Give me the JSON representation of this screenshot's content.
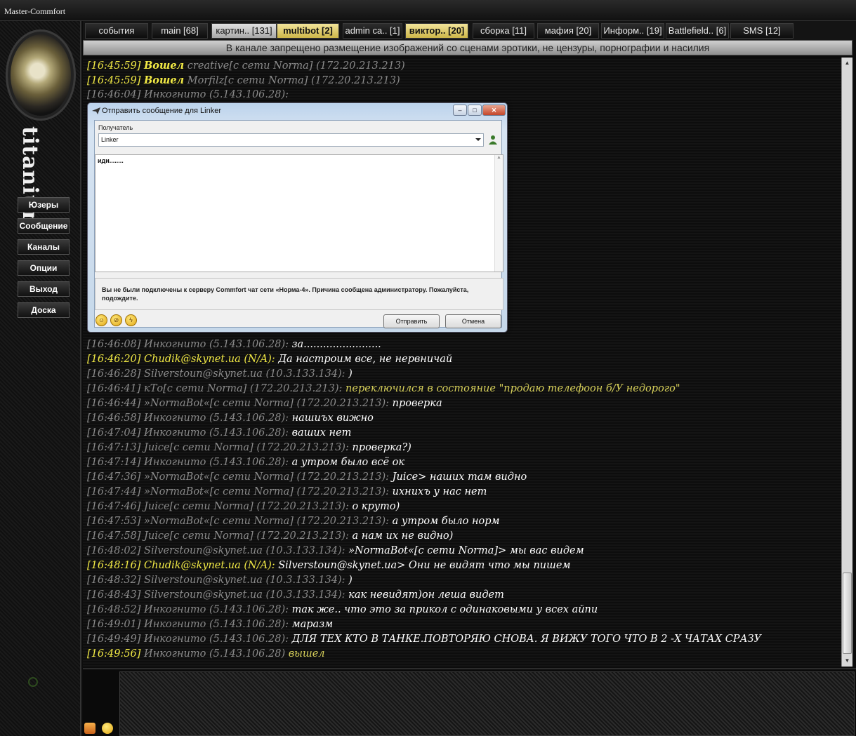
{
  "window": {
    "title": "Master-Commfort"
  },
  "sidebar": {
    "brand": "titanium",
    "buttons": [
      "Юзеры",
      "Сообщение",
      "Каналы",
      "Опции",
      "Выход",
      "Доска"
    ]
  },
  "tabs": [
    {
      "label": "события"
    },
    {
      "label": "main [68]"
    },
    {
      "label": "картин.. [131]"
    },
    {
      "label": "multibot [2]"
    },
    {
      "label": "admin ca.. [1]"
    },
    {
      "label": "виктор.. [20]"
    },
    {
      "label": "сборка [11]"
    },
    {
      "label": "мафия [20]"
    },
    {
      "label": "Информ.. [19]"
    },
    {
      "label": "Battlefield.. [6]"
    },
    {
      "label": "SMS [12]"
    }
  ],
  "notice": "В канале запрещено размещение изображений со сценами эротики, не цензуры, порнографии и насилия",
  "chat": [
    {
      "ts": "[16:45:59]",
      "nick": "Вошел",
      "msg": "creative[с сети Norma] (172.20.213.213)"
    },
    {
      "ts": "[16:45:59]",
      "nick": "Вошел",
      "msg": "Morfilz[с сети Norma] (172.20.213.213)"
    },
    {
      "ts": "[16:46:04]",
      "nick": "Инкогнито (5.143.106.28):",
      "msg": ""
    },
    {
      "ts": "[16:46:08]",
      "nick": "Инкогнито (5.143.106.28):",
      "msg": "за........................"
    },
    {
      "ts": "[16:46:20]",
      "nick": "Chudik@skynet.ua (N/A):",
      "msg": "Да настроим все, не нервничай"
    },
    {
      "ts": "[16:46:28]",
      "nick": "Silverstoun@skynet.ua (10.3.133.134):",
      "msg": ")"
    },
    {
      "ts": "[16:46:41]",
      "nick": "кТо[с сети Norma] (172.20.213.213):",
      "msg": "переключился в состояние \"продаю телефоон б/У недорого\""
    },
    {
      "ts": "[16:46:44]",
      "nick": "»NormaBot«[с сети Norma] (172.20.213.213):",
      "msg": "проверка"
    },
    {
      "ts": "[16:46:58]",
      "nick": "Инкогнито (5.143.106.28):",
      "msg": "нашиъх вижно"
    },
    {
      "ts": "[16:47:04]",
      "nick": "Инкогнито (5.143.106.28):",
      "msg": "ваших нет"
    },
    {
      "ts": "[16:47:13]",
      "nick": "Juice[с сети Norma] (172.20.213.213):",
      "msg": "проверка?)"
    },
    {
      "ts": "[16:47:14]",
      "nick": "Инкогнито (5.143.106.28):",
      "msg": "а утром было всё ок"
    },
    {
      "ts": "[16:47:36]",
      "nick": "»NormaBot«[с сети Norma] (172.20.213.213):",
      "msg": "Juice> наших там видно"
    },
    {
      "ts": "[16:47:44]",
      "nick": "»NormaBot«[с сети Norma] (172.20.213.213):",
      "msg": "ихнихъ у нас нет"
    },
    {
      "ts": "[16:47:46]",
      "nick": "Juice[с сети Norma] (172.20.213.213):",
      "msg": "о круто)"
    },
    {
      "ts": "[16:47:53]",
      "nick": "»NormaBot«[с сети Norma] (172.20.213.213):",
      "msg": "а утром было норм"
    },
    {
      "ts": "[16:47:58]",
      "nick": "Juice[с сети Norma] (172.20.213.213):",
      "msg": "а нам их не видно)"
    },
    {
      "ts": "[16:48:02]",
      "nick": "Silverstoun@skynet.ua (10.3.133.134):",
      "msg": "»NormaBot«[с сети Norma]> мы вас видем"
    },
    {
      "ts": "[16:48:16]",
      "nick": "Chudik@skynet.ua (N/A):",
      "msg": "Silverstoun@skynet.ua> Они не видят что мы пишем"
    },
    {
      "ts": "[16:48:32]",
      "nick": "Silverstoun@skynet.ua (10.3.133.134):",
      "msg": ")"
    },
    {
      "ts": "[16:48:43]",
      "nick": "Silverstoun@skynet.ua (10.3.133.134):",
      "msg": "как невидят)он леша видет"
    },
    {
      "ts": "[16:48:52]",
      "nick": "Инкогнито (5.143.106.28):",
      "msg": "так же.. что это за прикол с одинаковыми у всех айпи"
    },
    {
      "ts": "[16:49:01]",
      "nick": "Инкогнито (5.143.106.28):",
      "msg": "маразм"
    },
    {
      "ts": "[16:49:49]",
      "nick": "Инкогнито (5.143.106.28):",
      "msg": "ДЛЯ ТЕХ КТО В ТАНКЕ.ПОВТОРЯЮ СНОВА. Я ВИЖУ ТОГО ЧТО В 2 -Х ЧАТАХ СРАЗУ"
    },
    {
      "ts": "[16:49:56]",
      "nick": "Инкогнито (5.143.106.28)",
      "msg": "вышел"
    }
  ],
  "dialog": {
    "title": "Отправить сообщение для Linker",
    "recipient_label": "Получатель",
    "recipient_value": "Linker",
    "message_text": "иди........",
    "status_text": "Вы не были подключены к серверу Commfort чат сети «Норма-4». Причина сообщена администратору. Пожалуйста, подождите.",
    "send_label": "Отправить",
    "cancel_label": "Отмена"
  },
  "colors": {
    "timestamp": "#8a8a8a",
    "highlight": "#f2ea45",
    "message": "#ffffff",
    "status_message": "#d7d05a",
    "tab_active": "#cdb649"
  }
}
